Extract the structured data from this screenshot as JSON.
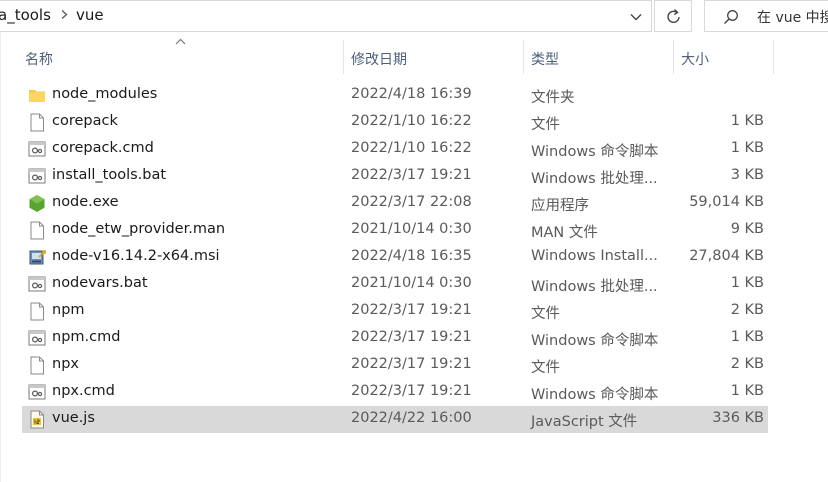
{
  "address": {
    "crumbs": [
      "a_tools",
      "vue"
    ],
    "search_placeholder": "在 vue 中搜"
  },
  "columns": {
    "name": "名称",
    "date": "修改日期",
    "type": "类型",
    "size": "大小"
  },
  "files": [
    {
      "name": "node_modules",
      "date": "2022/4/18 16:39",
      "type": "文件夹",
      "size": "",
      "icon": "folder-icon"
    },
    {
      "name": "corepack",
      "date": "2022/1/10 16:22",
      "type": "文件",
      "size": "1 KB",
      "icon": "file-icon"
    },
    {
      "name": "corepack.cmd",
      "date": "2022/1/10 16:22",
      "type": "Windows 命令脚本",
      "size": "1 KB",
      "icon": "cmd-file-icon"
    },
    {
      "name": "install_tools.bat",
      "date": "2022/3/17 19:21",
      "type": "Windows 批处理...",
      "size": "3 KB",
      "icon": "bat-file-icon"
    },
    {
      "name": "node.exe",
      "date": "2022/3/17 22:08",
      "type": "应用程序",
      "size": "59,014 KB",
      "icon": "node-exe-icon"
    },
    {
      "name": "node_etw_provider.man",
      "date": "2021/10/14 0:30",
      "type": "MAN 文件",
      "size": "9 KB",
      "icon": "file-icon"
    },
    {
      "name": "node-v16.14.2-x64.msi",
      "date": "2022/4/18 16:35",
      "type": "Windows Install...",
      "size": "27,804 KB",
      "icon": "msi-installer-icon"
    },
    {
      "name": "nodevars.bat",
      "date": "2021/10/14 0:30",
      "type": "Windows 批处理...",
      "size": "1 KB",
      "icon": "bat-file-icon"
    },
    {
      "name": "npm",
      "date": "2022/3/17 19:21",
      "type": "文件",
      "size": "2 KB",
      "icon": "file-icon"
    },
    {
      "name": "npm.cmd",
      "date": "2022/3/17 19:21",
      "type": "Windows 命令脚本",
      "size": "1 KB",
      "icon": "cmd-file-icon"
    },
    {
      "name": "npx",
      "date": "2022/3/17 19:21",
      "type": "文件",
      "size": "2 KB",
      "icon": "file-icon"
    },
    {
      "name": "npx.cmd",
      "date": "2022/3/17 19:21",
      "type": "Windows 命令脚本",
      "size": "1 KB",
      "icon": "cmd-file-icon"
    },
    {
      "name": "vue.js",
      "date": "2022/4/22 16:00",
      "type": "JavaScript 文件",
      "size": "336 KB",
      "icon": "js-file-icon",
      "selected": true
    }
  ],
  "colors": {
    "header_text": "#4c607a",
    "selection": "#d9d9d9",
    "folder": "#f8c94a",
    "node_green": "#5aa532"
  }
}
